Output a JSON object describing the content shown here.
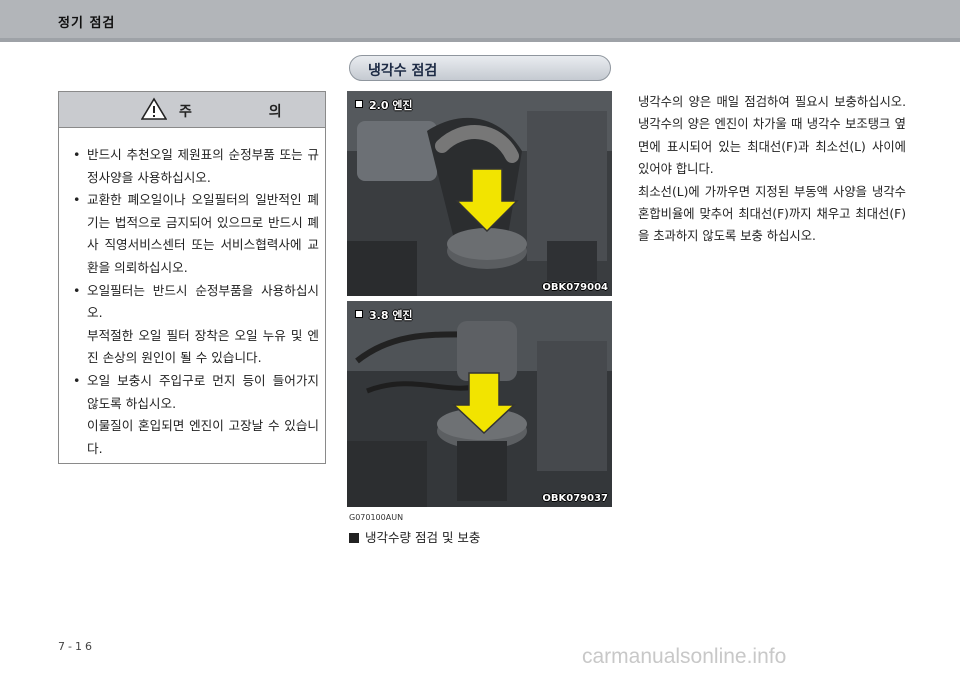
{
  "header": {
    "title": "정기 점검"
  },
  "section": {
    "title": "냉각수 점검"
  },
  "caution": {
    "title": "주 의",
    "items": [
      {
        "lines": [
          "반드시 추천오일 제원표의 순정부품 또는 규정사양을 사용하십시오."
        ]
      },
      {
        "lines": [
          "교환한 폐오일이나 오일필터의 일반적인 폐기는 법적으로 금지되어 있으므로 반드시 폐사 직영서비스센터 또는 서비스협력사에 교환을 의뢰하십시오."
        ]
      },
      {
        "lines": [
          "오일필터는 반드시 순정부품을 사용하십시오.",
          "부적절한 오일 필터 장착은 오일 누유 및 엔진 손상의 원인이 될 수 있습니다."
        ]
      },
      {
        "lines": [
          "오일 보충시 주입구로 먼지 등이 들어가지 않도록 하십시오.",
          "이물질이 혼입되면 엔진이 고장날 수 있습니다."
        ]
      }
    ]
  },
  "photos": [
    {
      "engine_label": "2.0 엔진",
      "code": "OBK079004"
    },
    {
      "engine_label": "3.8 엔진",
      "code": "OBK079037"
    }
  ],
  "doc_code": "G070100AUN",
  "figure_caption": "냉각수량 점검 및 보충",
  "body": {
    "p1": "냉각수의 양은 매일 점검하여 필요시 보충하십시오. 냉각수의 양은 엔진이 차가울 때 냉각수 보조탱크 옆면에 표시되어 있는 최대선(F)과 최소선(L) 사이에 있어야 합니다.",
    "p2": "최소선(L)에 가까우면 지정된 부동액 사양을 냉각수 혼합비율에 맞추어 최대선(F)까지 채우고 최대선(F)을 초과하지 않도록 보충 하십시오."
  },
  "page_number": "7-16",
  "watermark": "carmanualsonline.info",
  "colors": {
    "header_band": "#b2b5b9",
    "arrow": "#f2e400",
    "caution_head": "#c9cbcf"
  }
}
